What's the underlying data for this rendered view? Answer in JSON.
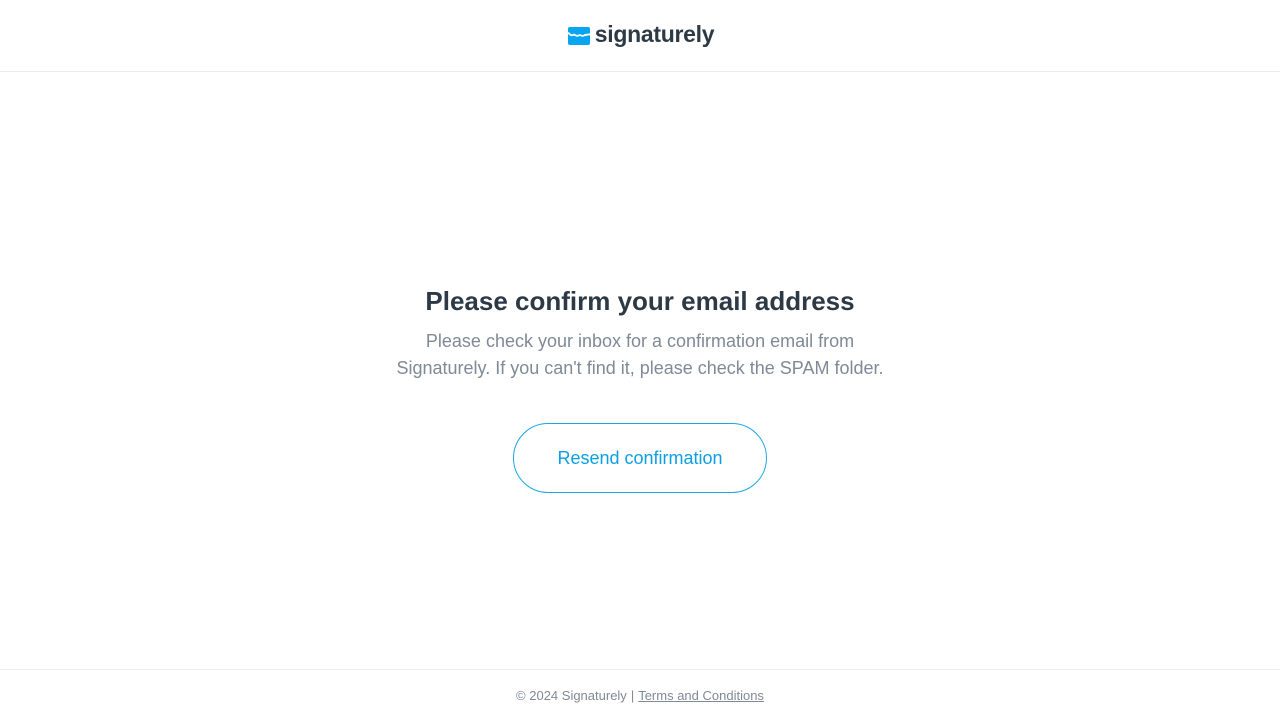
{
  "header": {
    "logo_text": "signaturely",
    "logo_icon": "signature-logo-icon",
    "brand_color": "#0aa5f0"
  },
  "main": {
    "title": "Please confirm your email address",
    "message": "Please check your inbox for a confirmation email from Signaturely. If you can't find it, please check the SPAM folder.",
    "resend_button_label": "Resend confirmation"
  },
  "footer": {
    "copyright": "© 2024 Signaturely",
    "separator": "|",
    "terms_link": "Terms and Conditions"
  },
  "colors": {
    "heading": "#2d3a46",
    "muted_text": "#7f8a96",
    "accent": "#0b9fe3",
    "divider": "#e9edf0"
  }
}
